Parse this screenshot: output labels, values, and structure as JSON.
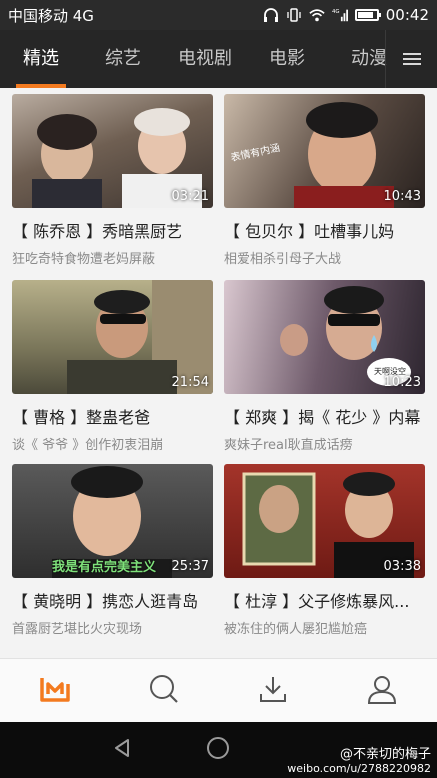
{
  "status_bar": {
    "carrier": "中国移动 4G",
    "time": "00:42",
    "battery_level": 0.85,
    "mini_network": "4G"
  },
  "tabs": [
    {
      "label": "精选",
      "active": true
    },
    {
      "label": "综艺",
      "active": false
    },
    {
      "label": "电视剧",
      "active": false
    },
    {
      "label": "电影",
      "active": false
    },
    {
      "label": "动漫",
      "active": false
    }
  ],
  "videos": [
    {
      "duration": "03:21",
      "title": "【 陈乔恩 】秀暗黑厨艺",
      "subtitle": "狂吃奇特食物遭老妈屏蔽",
      "thumb_color": "#7a6a5c"
    },
    {
      "duration": "10:43",
      "title": "【 包贝尔 】吐槽事儿妈",
      "subtitle": "相爱相杀引母子大战",
      "thumb_color": "#5c4f46",
      "overlay": "表情有内涵"
    },
    {
      "duration": "21:54",
      "title": "【 曹格 】整蛊老爸",
      "subtitle": "谈《 爷爷 》创作初衷泪崩",
      "thumb_color": "#8c8a6a"
    },
    {
      "duration": "10:23",
      "title": "【 郑爽 】揭《 花少 》内幕",
      "subtitle": "爽妹子real耿直成话痨",
      "thumb_color": "#6b5a66",
      "overlay": "天啊没空"
    },
    {
      "duration": "25:37",
      "title": "【 黄晓明 】携恋人逛青岛",
      "subtitle": "首露厨艺堪比火灾现场",
      "thumb_color": "#4a4a4a",
      "overlay": "我是有点完美主义"
    },
    {
      "duration": "03:38",
      "title": "【 杜淳 】父子修炼暴风...",
      "subtitle": "被冻住的俩人屡犯尴尬癌",
      "thumb_color": "#8a2a22"
    }
  ],
  "bottom_nav": {
    "items": [
      {
        "name": "home",
        "icon": "logo-icon",
        "active": true
      },
      {
        "name": "search",
        "icon": "search-icon",
        "active": false
      },
      {
        "name": "download",
        "icon": "download-icon",
        "active": false
      },
      {
        "name": "profile",
        "icon": "user-icon",
        "active": false
      }
    ]
  },
  "watermark": {
    "handle": "@不亲切的梅子",
    "url": "weibo.com/u/2788220982"
  },
  "colors": {
    "accent": "#f37a1f",
    "tab_bg": "#262626",
    "status_bg": "#2b2b2b"
  }
}
